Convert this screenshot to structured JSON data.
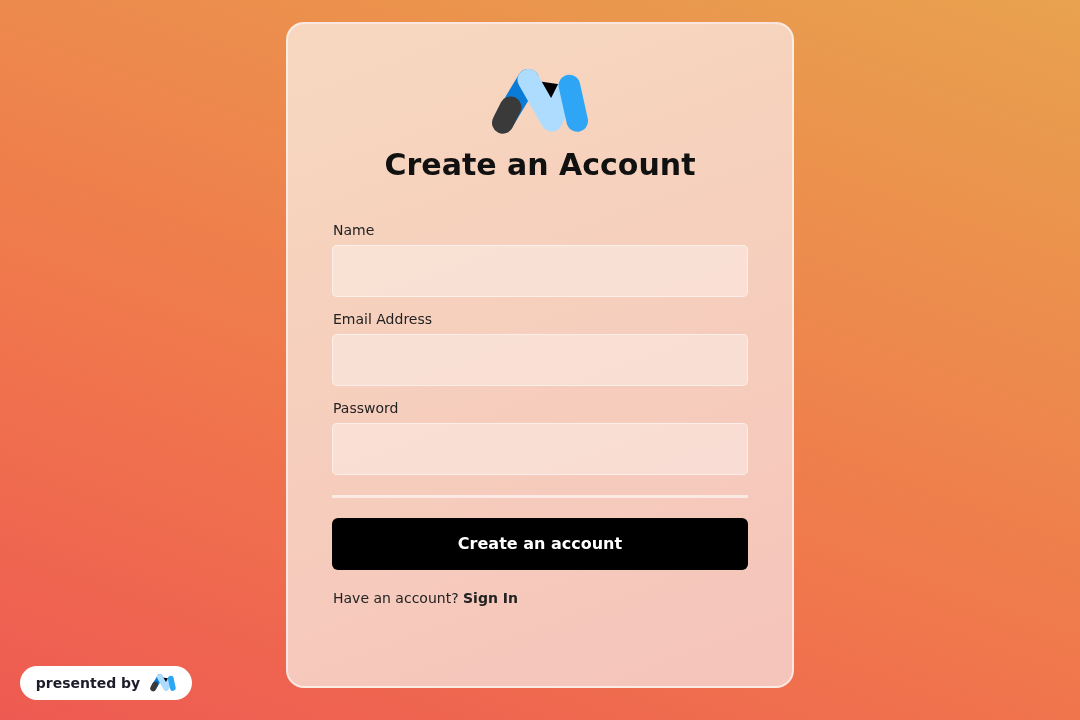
{
  "title": "Create an Account",
  "fields": [
    {
      "label": "Name"
    },
    {
      "label": "Email Address"
    },
    {
      "label": "Password"
    }
  ],
  "submit": "Create an account",
  "footer": {
    "prompt": "Have an account?",
    "link": "Sign In"
  },
  "badge": {
    "text": "presented by"
  }
}
